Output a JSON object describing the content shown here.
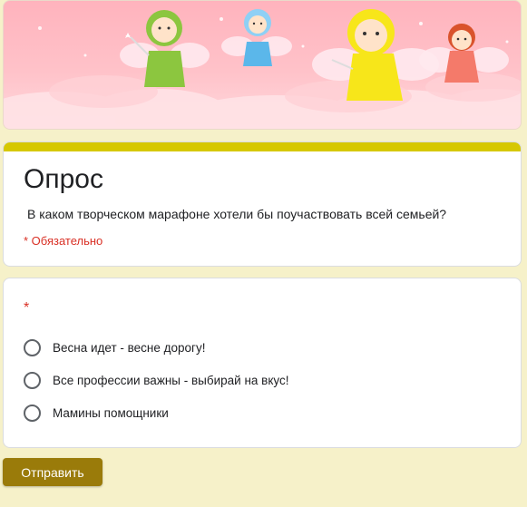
{
  "banner": {
    "image": "fairies-header-illustration"
  },
  "form": {
    "title": "Опрос",
    "description": "В каком творческом марафоне хотели бы поучаствовать всей семьей?",
    "required_note": "* Обязательно"
  },
  "question": {
    "required_mark": "*",
    "options": [
      {
        "label": "Весна идет - весне дорогу!"
      },
      {
        "label": "Все профессии важны - выбирай на вкус!"
      },
      {
        "label": "Мамины помощники"
      }
    ]
  },
  "submit": {
    "label": "Отправить"
  },
  "colors": {
    "page_background": "#f6f1c9",
    "accent_bar": "#d6c800",
    "submit_button": "#9a7b0a",
    "required": "#d93025"
  }
}
